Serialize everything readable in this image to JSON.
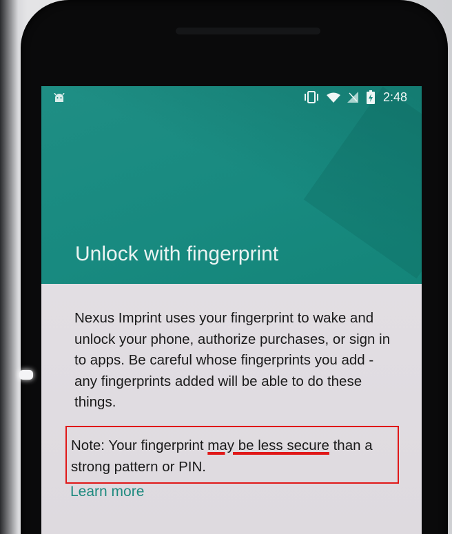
{
  "status_bar": {
    "time": "2:48",
    "icons": [
      "android-icon",
      "vibrate-icon",
      "wifi-icon",
      "signal-icon",
      "battery-charging-icon"
    ]
  },
  "screen": {
    "title": "Unlock with fingerprint",
    "body": "Nexus Imprint uses your fingerprint to wake and unlock your phone, authorize purchases, or sign in to apps. Be careful whose fingerprints you add - any fingerprints added will be able to do these things.",
    "note": {
      "before": "Note: Your fingerprint ",
      "highlight": "may be less secure",
      "after": " than a strong pattern or PIN."
    },
    "learn_more": "Learn more"
  },
  "colors": {
    "header_teal": "#188a80",
    "link_teal": "#1e8a7f",
    "annotation_red": "#e01818",
    "content_bg": "#e2dee3"
  }
}
